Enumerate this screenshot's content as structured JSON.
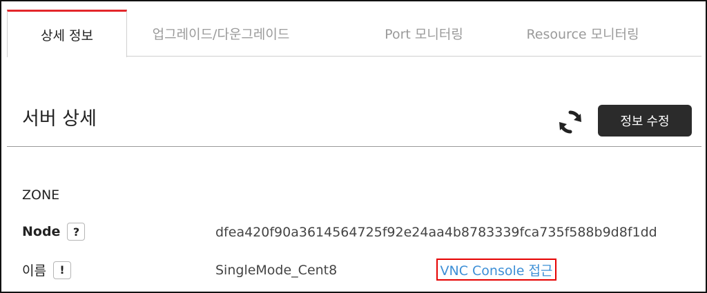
{
  "tabs": [
    {
      "label": "상세 정보",
      "active": true
    },
    {
      "label": "업그레이드/다운그레이드",
      "active": false
    },
    {
      "label": "Port 모니터링",
      "active": false
    },
    {
      "label": "Resource 모니터링",
      "active": false
    }
  ],
  "header": {
    "title": "서버 상세",
    "refresh_icon": "refresh-icon",
    "edit_button": "정보 수정"
  },
  "details": {
    "zone_label": "ZONE",
    "node_label": "Node",
    "node_help": "?",
    "node_value": "dfea420f90a3614564725f92e24aa4b8783339fca735f588b9d8f1dd",
    "name_label": "이름",
    "name_help": "!",
    "name_value": "SingleMode_Cent8",
    "vnc_link": "VNC Console 접근"
  },
  "colors": {
    "accent": "#e3262b",
    "button_bg": "#2b2b2b",
    "link": "#3d8fd6",
    "highlight_box": "#e60000"
  }
}
